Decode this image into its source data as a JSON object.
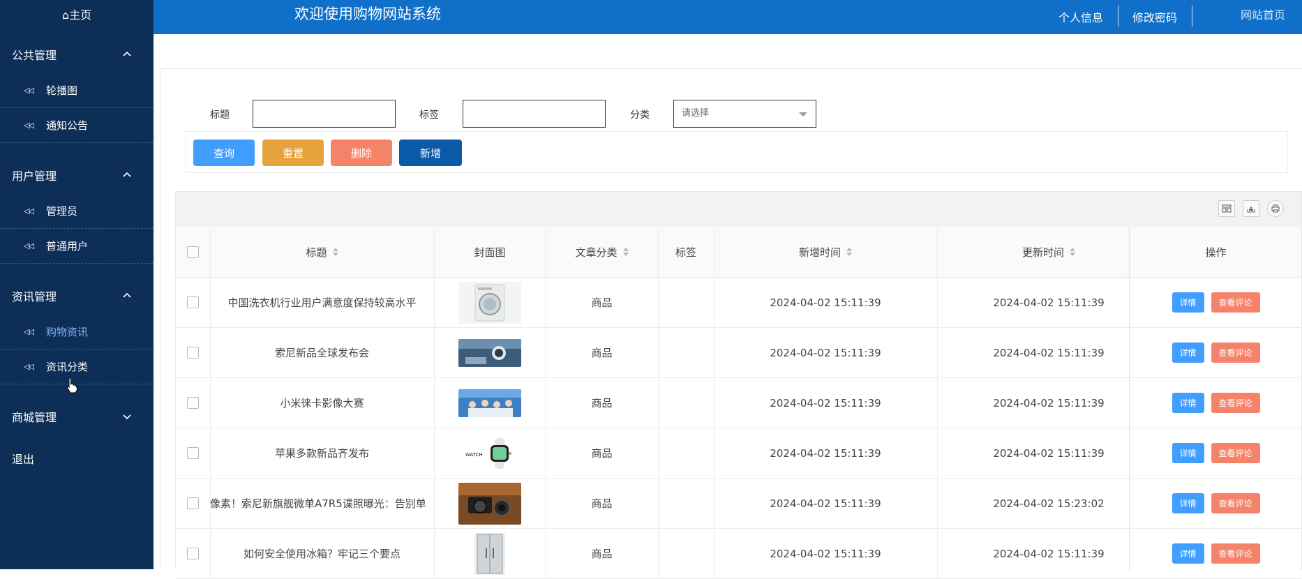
{
  "sidebar": {
    "home": "⌂主页",
    "groups": [
      {
        "label": "公共管理",
        "items": [
          "轮播图",
          "通知公告"
        ]
      },
      {
        "label": "用户管理",
        "items": [
          "管理员",
          "普通用户"
        ]
      },
      {
        "label": "资讯管理",
        "items": [
          "购物资讯",
          "资讯分类"
        ]
      },
      {
        "label": "商城管理"
      }
    ],
    "logout": "退出",
    "active_item": "购物资讯"
  },
  "header": {
    "title": "欢迎使用购物网站系统",
    "profile": "个人信息",
    "change_password": "修改密码",
    "site_home": "网站首页"
  },
  "search": {
    "title_label": "标题",
    "tag_label": "标签",
    "category_label": "分类",
    "category_placeholder": "请选择"
  },
  "buttons": {
    "query": "查询",
    "reset": "重置",
    "delete": "删除",
    "add": "新增"
  },
  "table": {
    "headers": [
      "标题",
      "封面图",
      "文章分类",
      "标签",
      "新增时间",
      "更新时间",
      "操作"
    ],
    "detail_label": "详情",
    "comments_label": "查看评论",
    "rows": [
      {
        "title": "中国洗衣机行业用户满意度保持较高水平",
        "category": "商品",
        "tag": "",
        "created": "2024-04-02 15:11:39",
        "updated": "2024-04-02 15:11:39",
        "thumb": "washing-machine"
      },
      {
        "title": "索尼新品全球发布会",
        "category": "商品",
        "tag": "",
        "created": "2024-04-02 15:11:39",
        "updated": "2024-04-02 15:11:39",
        "thumb": "astronaut"
      },
      {
        "title": "小米徕卡影像大赛",
        "category": "商品",
        "tag": "",
        "created": "2024-04-02 15:11:39",
        "updated": "2024-04-02 15:11:39",
        "thumb": "group-photo"
      },
      {
        "title": "苹果多款新品齐发布",
        "category": "商品",
        "tag": "",
        "created": "2024-04-02 15:11:39",
        "updated": "2024-04-02 15:11:39",
        "thumb": "apple-watch"
      },
      {
        "title": "像素！索尼新旗舰微单A7R5谍照曝光：告别单",
        "category": "商品",
        "tag": "",
        "created": "2024-04-02 15:11:39",
        "updated": "2024-04-02 15:23:02",
        "thumb": "camera"
      },
      {
        "title": "如何安全使用冰箱？牢记三个要点",
        "category": "商品",
        "tag": "",
        "created": "2024-04-02 15:11:39",
        "updated": "2024-04-02 15:11:39",
        "thumb": "fridge"
      }
    ]
  },
  "colors": {
    "sidebar_bg": "#0d2e57",
    "header_bg": "#0f6fc9",
    "query": "#409eff",
    "reset": "#e6a23c",
    "delete": "#f5836a",
    "add": "#0b5aa8",
    "detail": "#409eff",
    "comments": "#f5836a"
  }
}
